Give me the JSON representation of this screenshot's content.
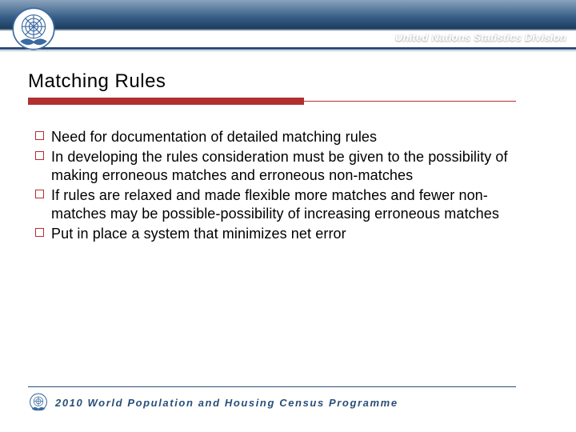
{
  "header": {
    "org_text": "United Nations Statistics Division"
  },
  "title": "Matching Rules",
  "bullets": [
    "Need for documentation of detailed matching rules",
    "In developing the rules consideration must be given to the possibility of making erroneous matches and erroneous non-matches",
    "If rules are relaxed and made flexible more matches and fewer non-matches may be possible-possibility of increasing erroneous matches",
    "Put in place a system that minimizes net error"
  ],
  "footer": {
    "programme_text": "2010 World Population and Housing Census Programme"
  }
}
